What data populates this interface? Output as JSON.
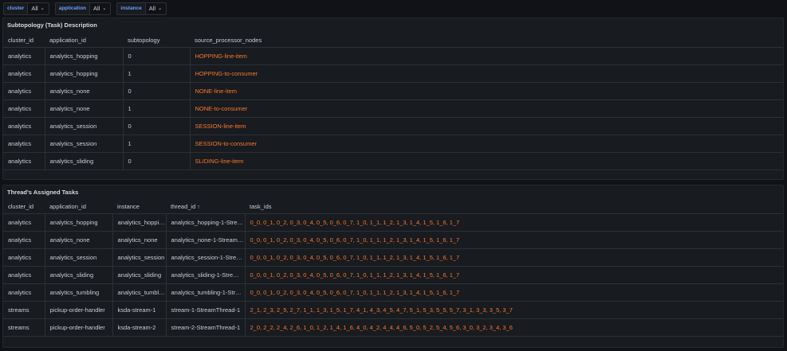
{
  "variables": [
    {
      "label": "cluster",
      "value": "All"
    },
    {
      "label": "application",
      "value": "All"
    },
    {
      "label": "instance",
      "value": "All"
    }
  ],
  "panel1": {
    "title": "Subtopology (Task) Description",
    "columns": [
      "cluster_id",
      "application_id",
      "subtopology",
      "source_processor_nodes"
    ],
    "rows": [
      [
        "analytics",
        "analytics_hopping",
        "0",
        "HOPPING-line-item"
      ],
      [
        "analytics",
        "analytics_hopping",
        "1",
        "HOPPING-to-consumer"
      ],
      [
        "analytics",
        "analytics_none",
        "0",
        "NONE-line-item"
      ],
      [
        "analytics",
        "analytics_none",
        "1",
        "NONE-to-consumer"
      ],
      [
        "analytics",
        "analytics_session",
        "0",
        "SESSION-line-item"
      ],
      [
        "analytics",
        "analytics_session",
        "1",
        "SESSION-to-consumer"
      ],
      [
        "analytics",
        "analytics_sliding",
        "0",
        "SLIDING-line-item"
      ]
    ]
  },
  "panel2": {
    "title": "Thread's Assigned Tasks",
    "columns": [
      "cluster_id",
      "application_id",
      "instance",
      "thread_id",
      "task_ids"
    ],
    "sort_arrow": "↑",
    "rows": [
      [
        "analytics",
        "analytics_hopping",
        "analytics_hopping",
        "analytics_hopping-1-Stre…",
        "0_0, 0_1, 0_2, 0_3, 0_4, 0_5, 0_6, 0_7, 1_0, 1_1, 1_2, 1_3, 1_4, 1_5, 1_6, 1_7"
      ],
      [
        "analytics",
        "analytics_none",
        "analytics_none",
        "analytics_none-1-Stream…",
        "0_0, 0_1, 0_2, 0_3, 0_4, 0_5, 0_6, 0_7, 1_0, 1_1, 1_2, 1_3, 1_4, 1_5, 1_6, 1_7"
      ],
      [
        "analytics",
        "analytics_session",
        "analytics_session",
        "analytics_session-1-Strea…",
        "0_0, 0_1, 0_2, 0_3, 0_4, 0_5, 0_6, 0_7, 1_0, 1_1, 1_2, 1_3, 1_4, 1_5, 1_6, 1_7"
      ],
      [
        "analytics",
        "analytics_sliding",
        "analytics_sliding",
        "analytics_sliding-1-Stre…",
        "0_0, 0_1, 0_2, 0_3, 0_4, 0_5, 0_6, 0_7, 1_0, 1_1, 1_2, 1_3, 1_4, 1_5, 1_6, 1_7"
      ],
      [
        "analytics",
        "analytics_tumbling",
        "analytics_tumbli…",
        "analytics_tumbling-1-Stre…",
        "0_0, 0_1, 0_2, 0_3, 0_4, 0_5, 0_6, 0_7, 1_0, 1_1, 1_2, 1_3, 1_4, 1_5, 1_6, 1_7"
      ],
      [
        "streams",
        "pickup-order-handler",
        "ksda-stream-1",
        "stream-1-StreamThread-1",
        "2_1, 2_3, 2_5, 2_7, 1_1, 1_3, 1_5, 1_7, 4_1, 4_3, 4_5, 4_7, 5_1, 5_3, 5_5, 5_7, 3_1, 3_3, 3_5, 3_7"
      ],
      [
        "streams",
        "pickup-order-handler",
        "ksda-stream-2",
        "stream-2-StreamThread-1",
        "2_0, 2_2, 2_4, 2_6, 1_0, 1_2, 1_4, 1_6, 4_0, 4_2, 4_4, 4_6, 5_0, 5_2, 5_4, 5_6, 3_0, 3_2, 3_4, 3_6"
      ]
    ]
  },
  "colors": {
    "background": "#111217",
    "panel": "#181b1f",
    "accent_orange": "#f7792f",
    "variable_label": "#6e9fff"
  }
}
